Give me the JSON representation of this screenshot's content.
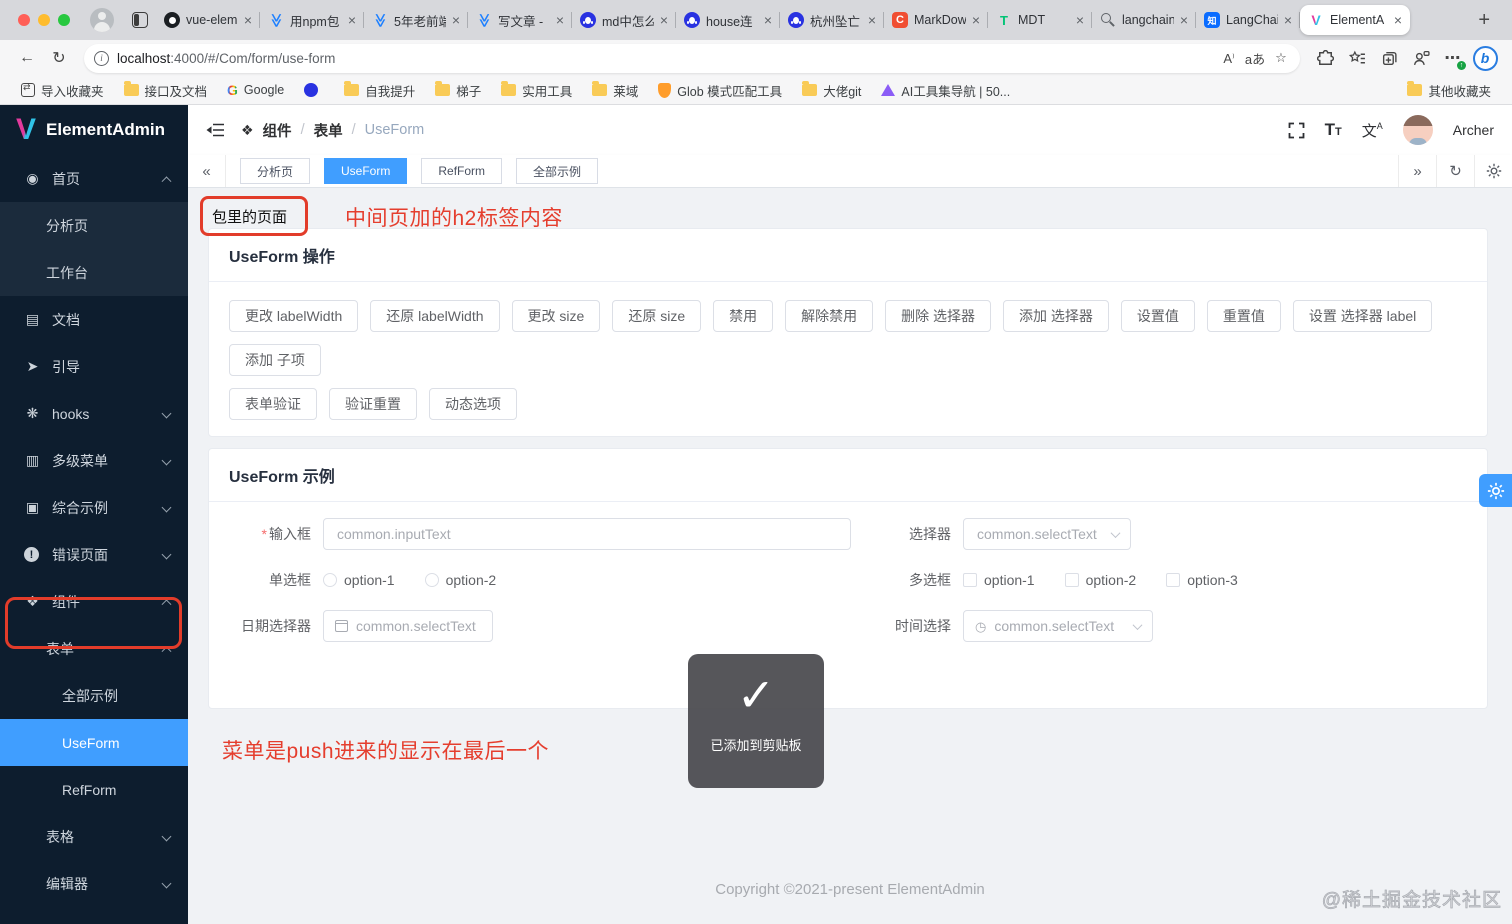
{
  "colors": {
    "accent": "#409eff",
    "annotation_red": "#e53e2e",
    "sidebar_bg": "#0d1d2e",
    "sidebar_active": "#409eff",
    "toast_bg": "#4a4a4e",
    "folder_yellow": "#f9cb57"
  },
  "browser": {
    "tabs": [
      {
        "title": "vue-elem",
        "icon": "github"
      },
      {
        "title": "用npm包",
        "icon": "juejin"
      },
      {
        "title": "5年老前端",
        "icon": "juejin"
      },
      {
        "title": "写文章 -",
        "icon": "juejin"
      },
      {
        "title": "md中怎么",
        "icon": "baidu"
      },
      {
        "title": "house连",
        "icon": "baidu"
      },
      {
        "title": "杭州坠亡",
        "icon": "baidu"
      },
      {
        "title": "MarkDow",
        "icon": "markdown"
      },
      {
        "title": "MDT",
        "icon": "mdt"
      },
      {
        "title": "langchain",
        "icon": "search"
      },
      {
        "title": "LangChai",
        "icon": "zhihu"
      },
      {
        "title": "ElementA",
        "icon": "element",
        "active": true
      }
    ],
    "url_host": "localhost",
    "url_rest": ":4000/#/Com/form/use-form",
    "bookmarks": [
      {
        "label": "导入收藏夹",
        "icon": "import"
      },
      {
        "label": "接口及文档",
        "icon": "folder"
      },
      {
        "label": "Google",
        "icon": "google"
      },
      {
        "label": "",
        "icon": "paw"
      },
      {
        "label": "自我提升",
        "icon": "folder"
      },
      {
        "label": "梯子",
        "icon": "folder"
      },
      {
        "label": "实用工具",
        "icon": "folder"
      },
      {
        "label": "莱域",
        "icon": "folder"
      },
      {
        "label": "Glob 模式匹配工具",
        "icon": "shield"
      },
      {
        "label": "大佬git",
        "icon": "folder"
      },
      {
        "label": "AI工具集导航 | 50...",
        "icon": "ai"
      }
    ],
    "other_bookmarks": {
      "label": "其他收藏夹"
    }
  },
  "sidebar": {
    "logo": "ElementAdmin",
    "menu": {
      "home": "首页",
      "analysis": "分析页",
      "workbench": "工作台",
      "docs": "文档",
      "guide": "引导",
      "hooks": "hooks",
      "multilevel": "多级菜单",
      "examples": "综合示例",
      "error_pages": "错误页面",
      "components": "组件",
      "form": "表单",
      "all_examples": "全部示例",
      "use_form": "UseForm",
      "ref_form": "RefForm",
      "table": "表格",
      "editor": "编辑器"
    }
  },
  "header": {
    "breadcrumb": [
      "组件",
      "表单",
      "UseForm"
    ],
    "user": "Archer"
  },
  "main": {
    "tags": [
      {
        "label": "分析页"
      },
      {
        "label": "UseForm",
        "active": true
      },
      {
        "label": "RefForm"
      },
      {
        "label": "全部示例"
      }
    ],
    "annotations": {
      "page_label": "包里的页面",
      "note_h2": "中间页加的h2标签内容",
      "note_menu": "菜单是push进来的显示在最后一个"
    },
    "ops": {
      "title": "UseForm 操作",
      "rows": [
        [
          "更改 labelWidth",
          "还原 labelWidth",
          "更改 size",
          "还原 size",
          "禁用",
          "解除禁用",
          "删除 选择器",
          "添加 选择器",
          "设置值",
          "重置值",
          "设置 选择器 label",
          "添加 子项"
        ],
        [
          "表单验证",
          "验证重置",
          "动态选项"
        ]
      ]
    },
    "demo": {
      "title": "UseForm 示例",
      "fields": {
        "input": {
          "label": "输入框",
          "required": "*",
          "placeholder": "common.inputText"
        },
        "select": {
          "label": "选择器",
          "placeholder": "common.selectText"
        },
        "radio": {
          "label": "单选框",
          "options": [
            "option-1",
            "option-2"
          ]
        },
        "checkbox": {
          "label": "多选框",
          "options": [
            "option-1",
            "option-2",
            "option-3"
          ]
        },
        "date": {
          "label": "日期选择器",
          "placeholder": "common.selectText"
        },
        "time": {
          "label": "时间选择",
          "placeholder": "common.selectText"
        }
      }
    },
    "toast": {
      "message": "已添加到剪贴板"
    },
    "footer": "Copyright ©2021-present ElementAdmin",
    "watermark": "@稀土掘金技术社区"
  }
}
